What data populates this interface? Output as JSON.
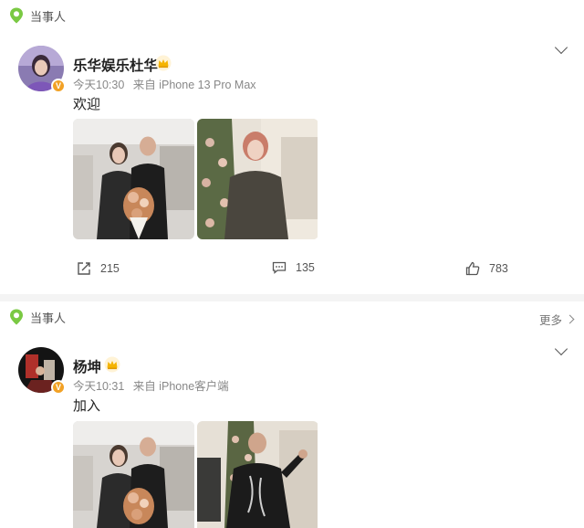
{
  "posts": [
    {
      "tag": "当事人",
      "author": "乐华娱乐杜华",
      "time": "今天10:30",
      "source": "来自 iPhone 13 Pro Max",
      "text": "欢迎",
      "badge": "V",
      "actions": {
        "repost": "215",
        "comment": "135",
        "like": "783"
      }
    },
    {
      "tag": "当事人",
      "more": "更多",
      "author": "杨坤",
      "time": "今天10:31",
      "source": "来自 iPhone客户端",
      "text": "加入",
      "badge": "V"
    }
  ],
  "colors": {
    "tag_green": "#7ac943",
    "badge_orange": "#f2a125",
    "crown_gold": "#f5b400"
  },
  "icons": [
    "location-pin-icon",
    "crown-icon",
    "verified-badge-icon",
    "expand-caret-icon",
    "repost-icon",
    "comment-icon",
    "like-icon",
    "chevron-right-icon"
  ]
}
